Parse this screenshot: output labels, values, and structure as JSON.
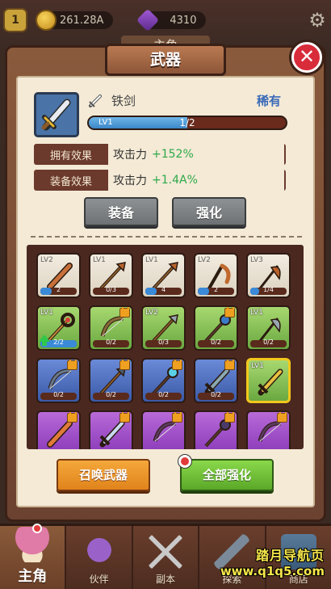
{
  "hud": {
    "player_level": "1",
    "coins": "261.28A",
    "gems": "4310",
    "bg_title": "主角"
  },
  "modal": {
    "title": "武器",
    "close_symbol": "✕"
  },
  "weapon": {
    "name": "铁剑",
    "rarity": "稀有",
    "level_label": "LV1",
    "progress_text": "1/2",
    "progress_fraction": 0.5
  },
  "effects": [
    {
      "label": "拥有效果",
      "stat": "攻击力",
      "bonus": "+152%"
    },
    {
      "label": "装备效果",
      "stat": "攻击力",
      "bonus": "+1.4A%"
    }
  ],
  "buttons": {
    "equip": "装备",
    "upgrade": "强化",
    "summon": "召唤武器",
    "upgrade_all": "全部强化"
  },
  "inventory": [
    {
      "lv": "LV2",
      "prog": "2",
      "fill": 0.3,
      "tier": "white",
      "locked": false,
      "art": "club"
    },
    {
      "lv": "LV1",
      "prog": "0/3",
      "fill": 0.0,
      "tier": "white",
      "locked": false,
      "art": "spear-brown"
    },
    {
      "lv": "LV1",
      "prog": "4",
      "fill": 0.3,
      "tier": "white",
      "locked": false,
      "art": "spear-brown"
    },
    {
      "lv": "LV2",
      "prog": "2",
      "fill": 0.3,
      "tier": "white",
      "locked": false,
      "art": "scythe-brown"
    },
    {
      "lv": "LV3",
      "prog": "1/4",
      "fill": 0.25,
      "tier": "white",
      "locked": false,
      "art": "blade-brown"
    },
    {
      "lv": "LV1",
      "prog": "2/2",
      "fill": 1.0,
      "tier": "green",
      "locked": false,
      "art": "staff-ring",
      "upgradable": true
    },
    {
      "lv": "",
      "prog": "0/2",
      "fill": 0.0,
      "tier": "green",
      "locked": true,
      "art": "bow"
    },
    {
      "lv": "LV2",
      "prog": "0/3",
      "fill": 0.0,
      "tier": "green",
      "locked": false,
      "art": "spear-steel"
    },
    {
      "lv": "",
      "prog": "0/2",
      "fill": 0.0,
      "tier": "green",
      "locked": true,
      "art": "staff-orb"
    },
    {
      "lv": "LV1",
      "prog": "0/2",
      "fill": 0.0,
      "tier": "green",
      "locked": false,
      "art": "axe-steel"
    },
    {
      "lv": "",
      "prog": "0/2",
      "fill": 0.0,
      "tier": "blue",
      "locked": true,
      "art": "bow-steel"
    },
    {
      "lv": "",
      "prog": "0/2",
      "fill": 0.0,
      "tier": "blue",
      "locked": true,
      "art": "trident"
    },
    {
      "lv": "",
      "prog": "0/2",
      "fill": 0.0,
      "tier": "blue",
      "locked": true,
      "art": "staff-blue"
    },
    {
      "lv": "",
      "prog": "0/2",
      "fill": 0.0,
      "tier": "blue",
      "locked": true,
      "art": "sword-green"
    },
    {
      "lv": "LV1",
      "prog": "",
      "fill": 0.0,
      "tier": "green",
      "locked": false,
      "art": "sword-gold",
      "selected": true
    },
    {
      "lv": "",
      "prog": "",
      "fill": 0.0,
      "tier": "purple",
      "locked": true,
      "art": "club-orange"
    },
    {
      "lv": "",
      "prog": "",
      "fill": 0.0,
      "tier": "purple",
      "locked": true,
      "art": "sword-ice"
    },
    {
      "lv": "",
      "prog": "",
      "fill": 0.0,
      "tier": "purple",
      "locked": true,
      "art": "bow-dark"
    },
    {
      "lv": "",
      "prog": "",
      "fill": 0.0,
      "tier": "purple",
      "locked": true,
      "art": "staff-dark"
    },
    {
      "lv": "",
      "prog": "",
      "fill": 0.0,
      "tier": "purple",
      "locked": true,
      "art": "bow-dark"
    }
  ],
  "nav": [
    {
      "label": "主角",
      "icon": "mushroom-icon",
      "active": true
    },
    {
      "label": "伙伴",
      "icon": "ghost-icon",
      "active": false
    },
    {
      "label": "副本",
      "icon": "crossed-swords-icon",
      "active": false
    },
    {
      "label": "探索",
      "icon": "shovel-icon",
      "active": false
    },
    {
      "label": "商店",
      "icon": "shop-icon",
      "active": false
    }
  ],
  "watermark": {
    "line1": "踏月导航页",
    "line2": "www.q1q5.com"
  },
  "colors": {
    "rarity": "#3a6ab8",
    "bonus": "#2fa84a",
    "modal_frame": "#7a4a34",
    "paper": "#f4ead6"
  }
}
